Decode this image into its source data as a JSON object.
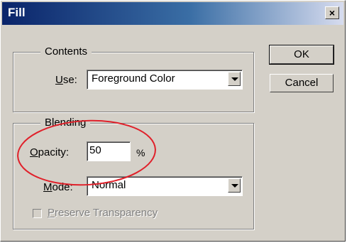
{
  "window": {
    "title": "Fill",
    "close_glyph": "×"
  },
  "contents": {
    "legend": "Contents",
    "use_label_prefix": "",
    "use_label_mnemonic": "U",
    "use_label_rest": "se:",
    "use_value": "Foreground Color"
  },
  "blending": {
    "legend": "Blending",
    "opacity_mnemonic": "O",
    "opacity_rest": "pacity:",
    "opacity_value": "50",
    "opacity_unit": "%",
    "mode_mnemonic": "M",
    "mode_rest": "ode:",
    "mode_value": "Normal",
    "preserve_mnemonic": "P",
    "preserve_rest": "reserve Transparency",
    "preserve_checked": false
  },
  "buttons": {
    "ok": "OK",
    "cancel": "Cancel"
  },
  "annotation_color": "#e0202a",
  "icons": {
    "close": "close-icon",
    "dropdown": "chevron-down-icon"
  }
}
